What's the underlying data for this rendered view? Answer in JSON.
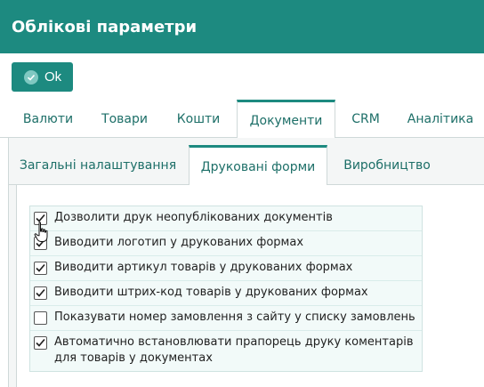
{
  "window": {
    "title": "Облікові параметри"
  },
  "toolbar": {
    "ok_label": "Ok"
  },
  "main_tabs": [
    {
      "label": "Валюти",
      "active": false
    },
    {
      "label": "Товари",
      "active": false
    },
    {
      "label": "Кошти",
      "active": false
    },
    {
      "label": "Документи",
      "active": true
    },
    {
      "label": "CRM",
      "active": false
    },
    {
      "label": "Аналітика",
      "active": false
    }
  ],
  "sub_tabs": [
    {
      "label": "Загальні налаштування",
      "active": false
    },
    {
      "label": "Друковані форми",
      "active": true
    },
    {
      "label": "Виробництво",
      "active": false
    }
  ],
  "options": [
    {
      "label": "Дозволити друк неопублікованих документів",
      "checked": true
    },
    {
      "label": "Виводити логотип у друкованих формах",
      "checked": true
    },
    {
      "label": "Виводити артикул товарів у друкованих формах",
      "checked": true
    },
    {
      "label": "Виводити штрих-код товарів у друкованих формах",
      "checked": true
    },
    {
      "label": "Показувати номер замовлення з сайту у списку замовлень",
      "checked": false
    },
    {
      "label": "Автоматично встановлювати прапорець друку коментарів для товарів у документах",
      "checked": true
    }
  ],
  "colors": {
    "accent": "#1d8a80",
    "row_bg": "#f2faf9"
  }
}
